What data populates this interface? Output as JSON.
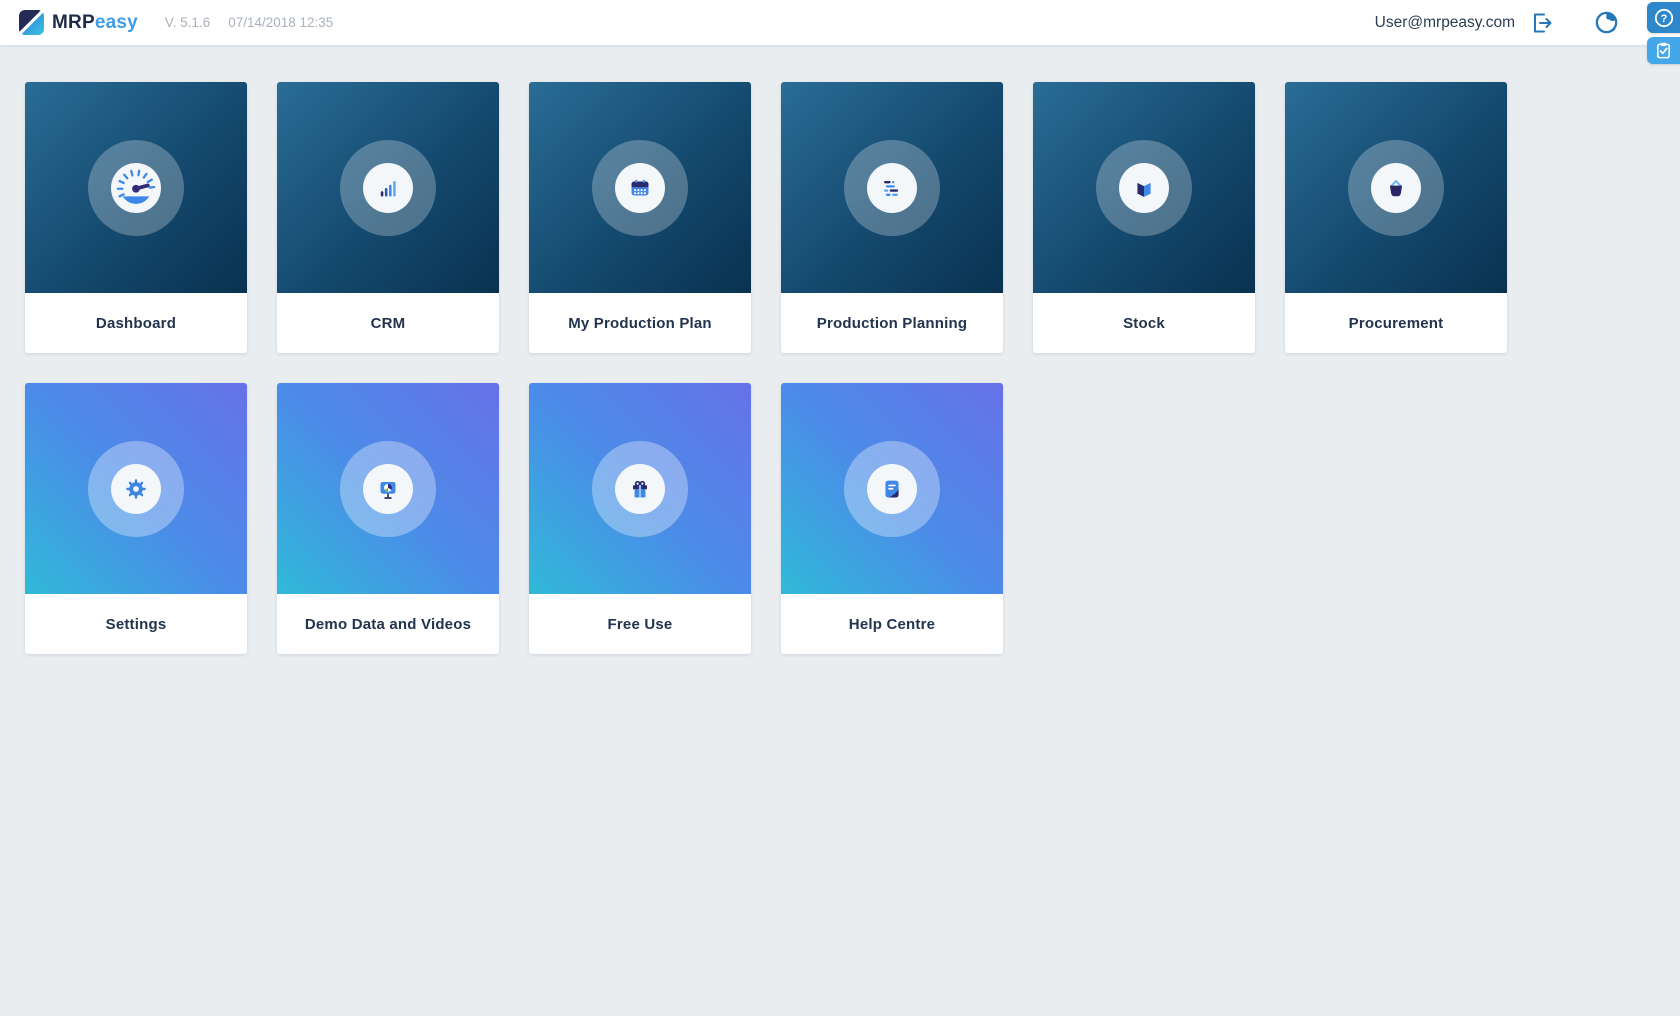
{
  "header": {
    "brand_mrp": "MRP",
    "brand_easy": "easy",
    "version": "V. 5.1.6",
    "datetime": "07/14/2018 12:35",
    "user_email": "User@mrpeasy.com",
    "logo_icon": "mrpeasy-logo",
    "logout_icon": "logout-icon",
    "globe_icon": "globe-icon"
  },
  "side_buttons": [
    {
      "name": "help-button",
      "icon": "help-icon",
      "glyph": "?"
    },
    {
      "name": "tasks-button",
      "icon": "clipboard-check-icon"
    }
  ],
  "tiles": [
    {
      "label": "Dashboard",
      "icon": "gauge-icon",
      "theme": "dark"
    },
    {
      "label": "CRM",
      "icon": "bar-chart-icon",
      "theme": "dark"
    },
    {
      "label": "My Production Plan",
      "icon": "calendar-icon",
      "theme": "dark"
    },
    {
      "label": "Production Planning",
      "icon": "gantt-icon",
      "theme": "dark"
    },
    {
      "label": "Stock",
      "icon": "box-icon",
      "theme": "dark"
    },
    {
      "label": "Procurement",
      "icon": "basket-icon",
      "theme": "dark"
    },
    {
      "label": "Settings",
      "icon": "gear-icon",
      "theme": "light"
    },
    {
      "label": "Demo Data and Videos",
      "icon": "presentation-icon",
      "theme": "light"
    },
    {
      "label": "Free Use",
      "icon": "gift-icon",
      "theme": "light"
    },
    {
      "label": "Help Centre",
      "icon": "document-icon",
      "theme": "light"
    }
  ],
  "colors": {
    "page_bg": "#e9edf0",
    "header_bg": "#ffffff",
    "brand_navy": "#1c2c4e",
    "brand_blue": "#3f9ce8",
    "muted_text": "#a9b1bb",
    "body_text": "#2c3e52",
    "label_text": "#22344e",
    "accent_blue": "#3f87e8",
    "icon_navy": "#2b2a6e",
    "header_icon_blue": "#2677b8",
    "dark_tile_top": "#2a6d96",
    "dark_tile_bottom": "#093250",
    "light_tile_top": "#6672e8",
    "light_tile_bottom": "#30b9d8",
    "help_button_bg": "#2d87ca",
    "tasks_button_bg": "#43a7e9"
  }
}
